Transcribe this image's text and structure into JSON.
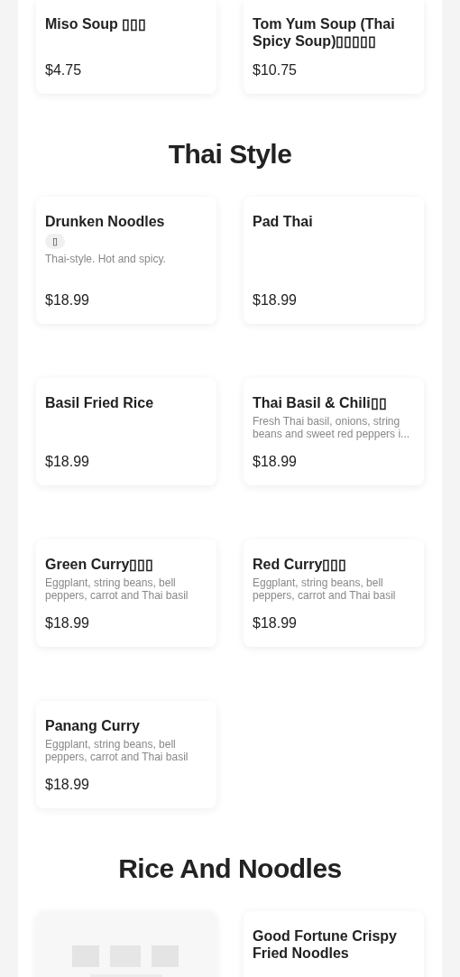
{
  "sections": [
    {
      "items": [
        {
          "name": "Miso Soup ▯▯▯",
          "price": "$4.75"
        },
        {
          "name": "Tom Yum Soup (Thai Spicy Soup)▯▯▯▯▯",
          "price": "$10.75"
        }
      ]
    },
    {
      "title": "Thai Style",
      "items": [
        {
          "name": "Drunken Noodles",
          "tag": "▯",
          "description": "Thai-style. Hot and spicy.",
          "price": "$18.99"
        },
        {
          "name": "Pad Thai",
          "price": "$18.99"
        },
        {
          "name": "Basil Fried Rice",
          "price": "$18.99"
        },
        {
          "name": "Thai Basil & Chili▯▯",
          "description": "Fresh Thai basil, onions, string beans and sweet red peppers i...",
          "price": "$18.99"
        },
        {
          "name": "Green Curry▯▯▯",
          "description": "Eggplant, string beans, bell peppers, carrot and Thai basil",
          "price": "$18.99"
        },
        {
          "name": "Red Curry▯▯▯",
          "description": "Eggplant, string beans, bell peppers, carrot and Thai basil",
          "price": "$18.99"
        },
        {
          "name": "Panang Curry",
          "description": "Eggplant, string beans, bell peppers, carrot and Thai basil",
          "price": "$18.99"
        }
      ]
    },
    {
      "title": "Rice And Noodles",
      "items": [
        {
          "kind": "picture"
        },
        {
          "name": "Good Fortune Crispy Fried Noodles"
        }
      ]
    }
  ]
}
